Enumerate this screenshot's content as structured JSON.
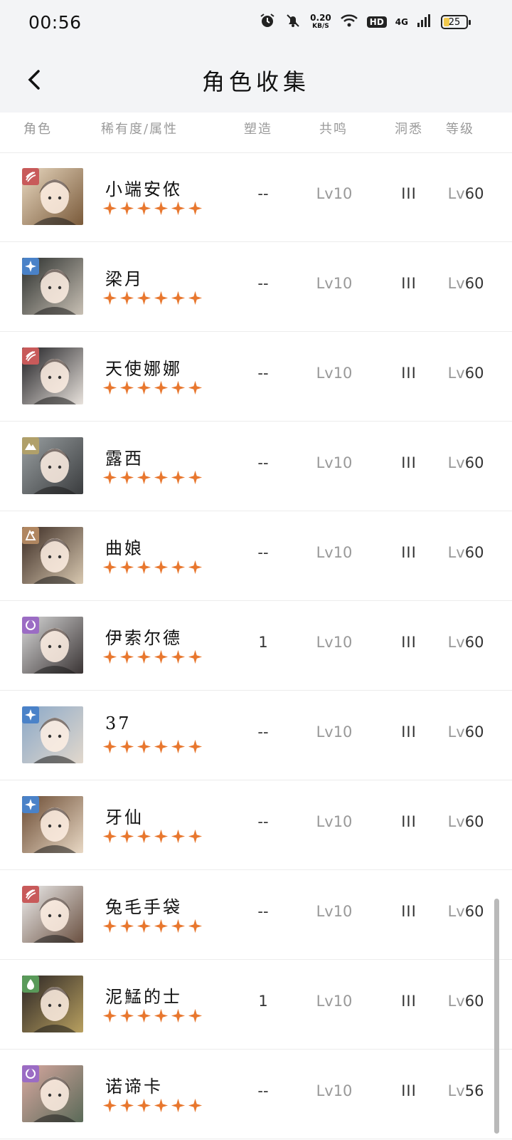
{
  "status_bar": {
    "time": "00:56",
    "speed_value": "0.20",
    "speed_unit": "KB/S",
    "hd": "HD",
    "network": "4G",
    "battery": "25"
  },
  "header": {
    "title": "角色收集"
  },
  "columns": {
    "character": "角色",
    "rarity": "稀有度/属性",
    "forge": "塑造",
    "resonance": "共鸣",
    "insight": "洞悉",
    "level": "等级"
  },
  "colors": {
    "star": "#e8772e",
    "red_attr": "#c85a5a",
    "blue_attr": "#4a82c8",
    "olive_attr": "#b0a06a",
    "brown_attr": "#b08660",
    "purple_attr": "#9b6cc4",
    "green_attr": "#5a9a5a"
  },
  "characters": [
    {
      "name": "小端安侬",
      "attr": "red",
      "attr_icon": "claw-icon",
      "forge": "--",
      "resonance": "Lv10",
      "insight": "III",
      "level_prefix": "Lv",
      "level_value": "60",
      "stars": 6
    },
    {
      "name": "梁月",
      "attr": "blue",
      "attr_icon": "star-icon",
      "forge": "--",
      "resonance": "Lv10",
      "insight": "III",
      "level_prefix": "Lv",
      "level_value": "60",
      "stars": 6
    },
    {
      "name": "天使娜娜",
      "attr": "red",
      "attr_icon": "claw-icon",
      "forge": "--",
      "resonance": "Lv10",
      "insight": "III",
      "level_prefix": "Lv",
      "level_value": "60",
      "stars": 6
    },
    {
      "name": "露西",
      "attr": "olive",
      "attr_icon": "mountain-icon",
      "forge": "--",
      "resonance": "Lv10",
      "insight": "III",
      "level_prefix": "Lv",
      "level_value": "60",
      "stars": 6
    },
    {
      "name": "曲娘",
      "attr": "brown",
      "attr_icon": "leaf-icon",
      "forge": "--",
      "resonance": "Lv10",
      "insight": "III",
      "level_prefix": "Lv",
      "level_value": "60",
      "stars": 6
    },
    {
      "name": "伊索尔德",
      "attr": "purple",
      "attr_icon": "moon-icon",
      "forge": "1",
      "resonance": "Lv10",
      "insight": "III",
      "level_prefix": "Lv",
      "level_value": "60",
      "stars": 6
    },
    {
      "name": "37",
      "attr": "blue",
      "attr_icon": "star-icon",
      "forge": "--",
      "resonance": "Lv10",
      "insight": "III",
      "level_prefix": "Lv",
      "level_value": "60",
      "stars": 6
    },
    {
      "name": "牙仙",
      "attr": "blue",
      "attr_icon": "star-icon",
      "forge": "--",
      "resonance": "Lv10",
      "insight": "III",
      "level_prefix": "Lv",
      "level_value": "60",
      "stars": 6
    },
    {
      "name": "兔毛手袋",
      "attr": "red",
      "attr_icon": "claw-icon",
      "forge": "--",
      "resonance": "Lv10",
      "insight": "III",
      "level_prefix": "Lv",
      "level_value": "60",
      "stars": 6
    },
    {
      "name": "泥鯭的士",
      "attr": "green",
      "attr_icon": "drop-icon",
      "forge": "1",
      "resonance": "Lv10",
      "insight": "III",
      "level_prefix": "Lv",
      "level_value": "60",
      "stars": 6
    },
    {
      "name": "诺谛卡",
      "attr": "purple",
      "attr_icon": "moon-icon",
      "forge": "--",
      "resonance": "Lv10",
      "insight": "III",
      "level_prefix": "Lv",
      "level_value": "56",
      "stars": 6
    }
  ]
}
